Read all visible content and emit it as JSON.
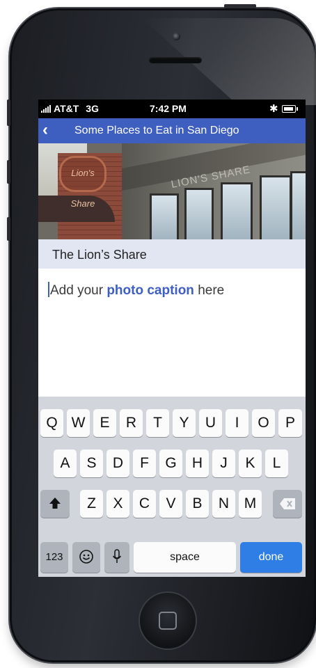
{
  "status_bar": {
    "carrier": "AT&T",
    "network": "3G",
    "time": "7:42 PM",
    "bluetooth_icon": "bluetooth-icon",
    "battery_icon": "battery-icon"
  },
  "nav": {
    "back_icon": "chevron-left-icon",
    "title": "Some Places to Eat in San Diego"
  },
  "photo": {
    "sign_text": "Lion's Share",
    "banner_text": "LION'S SHARE"
  },
  "place": {
    "name": "The Lion’s Share"
  },
  "caption": {
    "before": "Add your ",
    "emphasis": "photo caption",
    "after": " here"
  },
  "keyboard": {
    "row1": [
      "Q",
      "W",
      "E",
      "R",
      "T",
      "Y",
      "U",
      "I",
      "O",
      "P"
    ],
    "row2": [
      "A",
      "S",
      "D",
      "F",
      "G",
      "H",
      "J",
      "K",
      "L"
    ],
    "row3": [
      "Z",
      "X",
      "C",
      "V",
      "B",
      "N",
      "M"
    ],
    "shift_icon": "shift-icon",
    "delete_icon": "delete-icon",
    "numbers_label": "123",
    "emoji_icon": "emoji-icon",
    "mic_icon": "microphone-icon",
    "space_label": "space",
    "done_label": "done"
  },
  "colors": {
    "nav_blue": "#3e5fbf",
    "label_band": "#e2e6f2",
    "done_blue": "#2f7ee6",
    "keyboard_bg": "#d2d5db"
  }
}
